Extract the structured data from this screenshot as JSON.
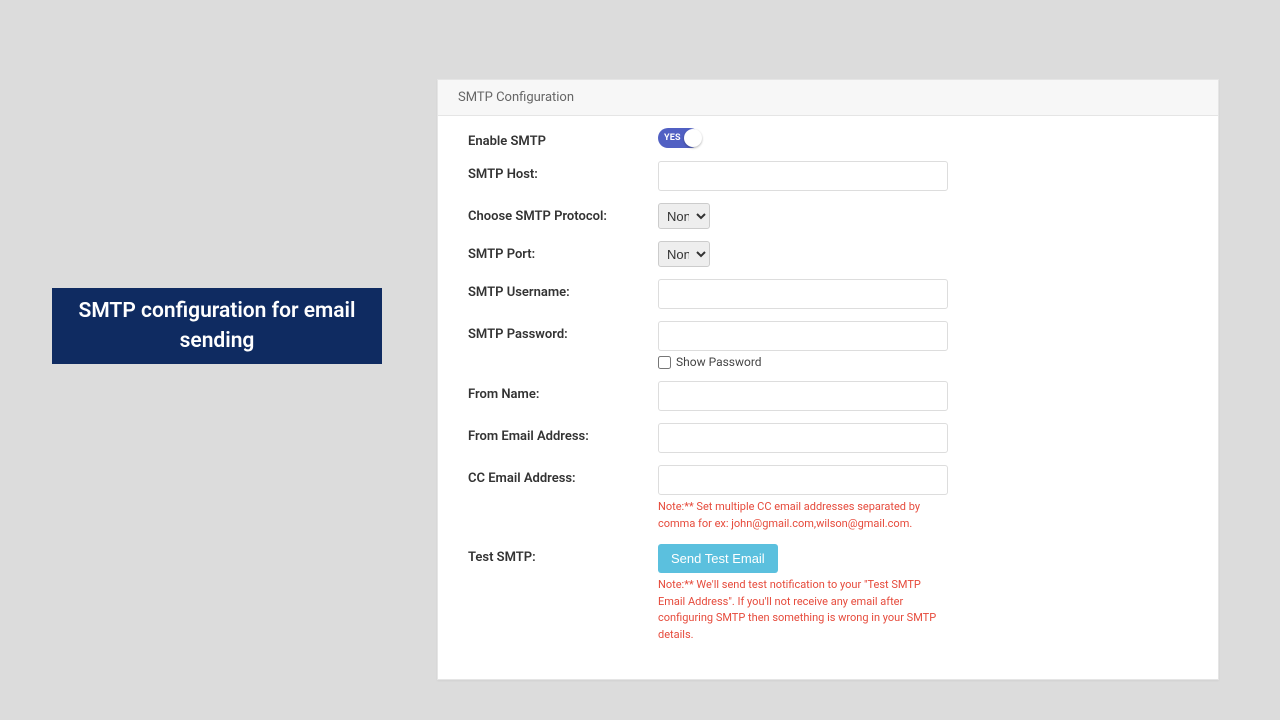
{
  "caption": "SMTP configuration for email sending",
  "panel": {
    "title": "SMTP Configuration",
    "enable_smtp_label": "Enable SMTP",
    "enable_smtp_toggle": "YES",
    "host_label": "SMTP Host:",
    "protocol_label": "Choose SMTP Protocol:",
    "protocol_value": "None",
    "port_label": "SMTP Port:",
    "port_value": "None",
    "username_label": "SMTP Username:",
    "password_label": "SMTP Password:",
    "show_password_label": "Show Password",
    "from_name_label": "From Name:",
    "from_email_label": "From Email Address:",
    "cc_email_label": "CC Email Address:",
    "cc_note": "Note:** Set multiple CC email addresses separated by comma for ex: john@gmail.com,wilson@gmail.com.",
    "test_label": "Test SMTP:",
    "send_test_button": "Send Test Email",
    "test_note": "Note:** We'll send test notification to your \"Test SMTP Email Address\". If you'll not receive any email after configuring SMTP then something is wrong in your SMTP details."
  }
}
